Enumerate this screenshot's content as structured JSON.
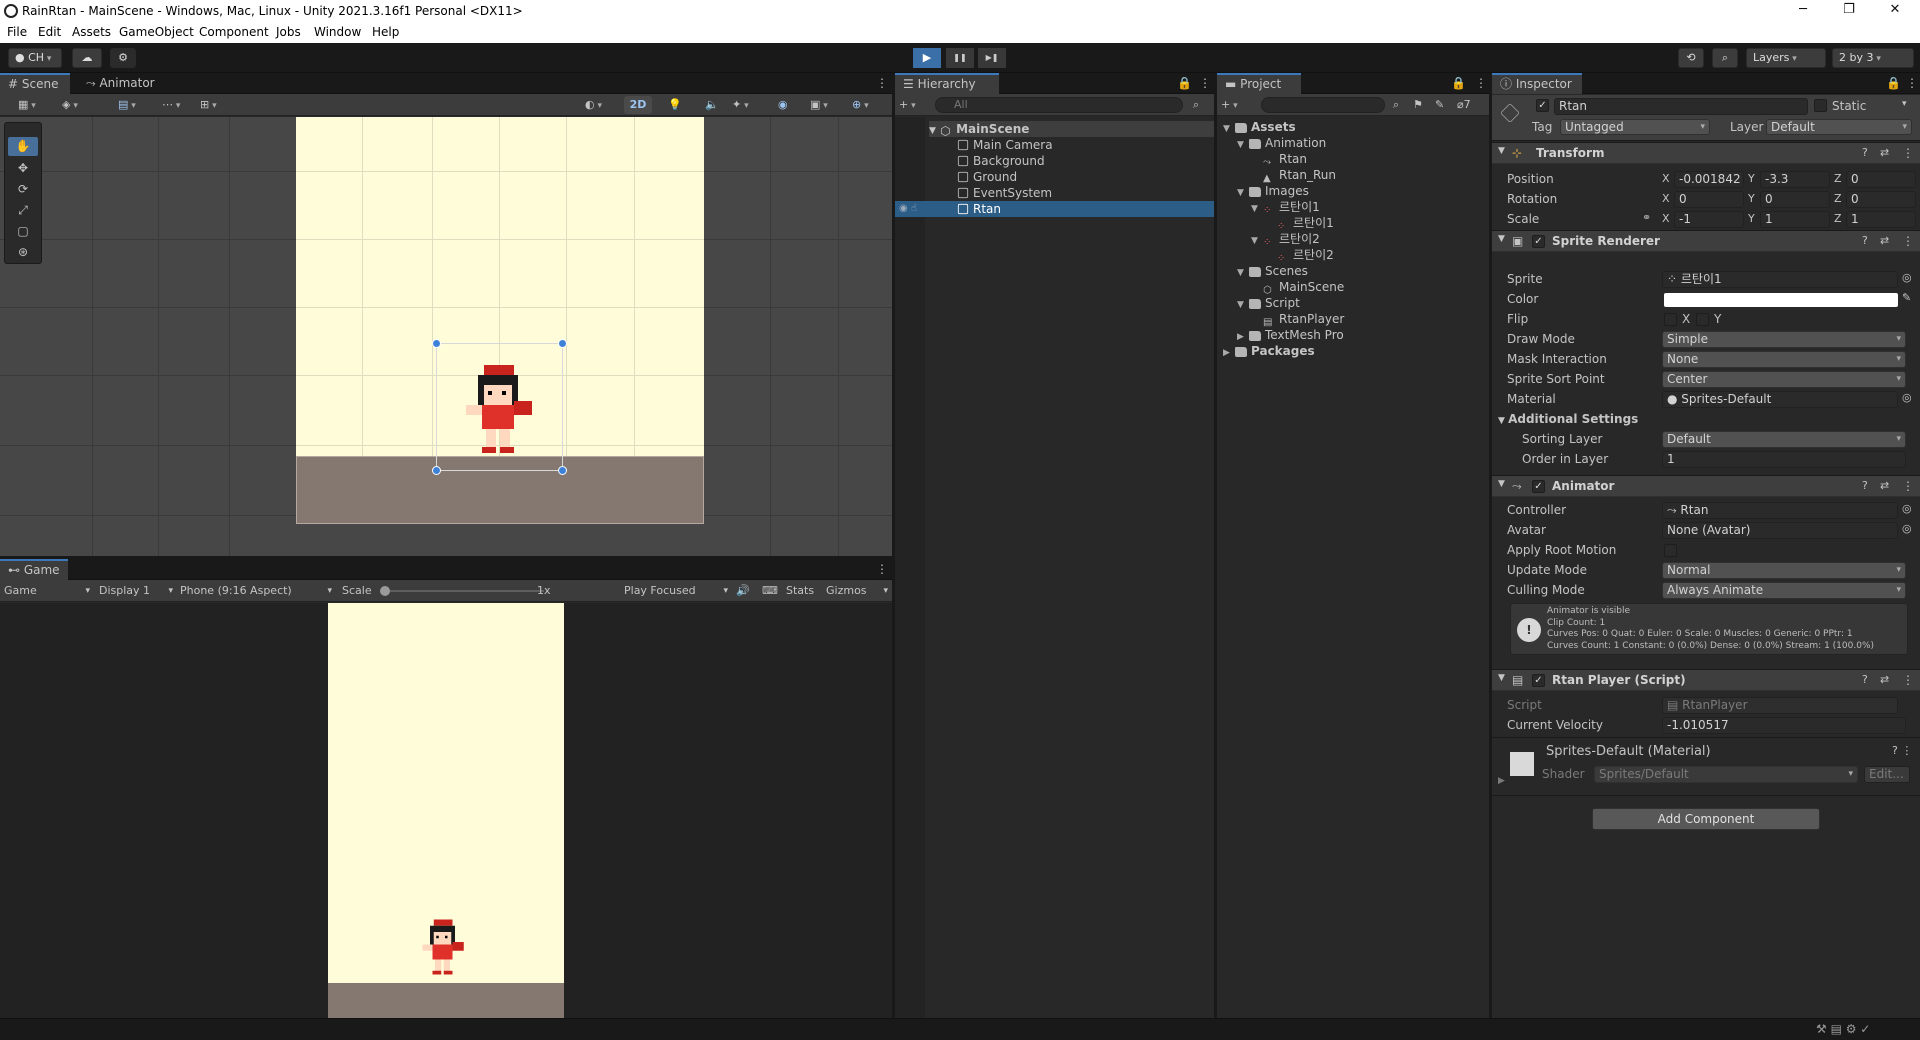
{
  "window": {
    "title": "RainRtan - MainScene - Windows, Mac, Linux - Unity 2021.3.16f1 Personal <DX11>",
    "minimize": "─",
    "maximize": "❐",
    "close": "✕"
  },
  "menu": [
    "File",
    "Edit",
    "Assets",
    "GameObject",
    "Component",
    "Jobs",
    "Window",
    "Help"
  ],
  "toolbar": {
    "account": "CH",
    "layers": "Layers",
    "layout": "2 by 3",
    "play": "▶",
    "pause": "❚❚",
    "step": "▶❚"
  },
  "scene": {
    "tabs": [
      "Scene",
      "Animator"
    ],
    "mode_2d": "2D"
  },
  "game": {
    "tab": "Game",
    "view_mode": "Game",
    "display": "Display 1",
    "aspect": "Phone (9:16 Aspect)",
    "scale_label": "Scale",
    "scale_value": "1x",
    "play_focused": "Play Focused",
    "stats": "Stats",
    "gizmos": "Gizmos"
  },
  "hierarchy": {
    "tab": "Hierarchy",
    "search_placeholder": "All",
    "scene": "MainScene",
    "items": [
      "Main Camera",
      "Background",
      "Ground",
      "EventSystem",
      "Rtan"
    ],
    "selected": "Rtan"
  },
  "project": {
    "tab": "Project",
    "count": "7",
    "tree": [
      {
        "label": "Assets",
        "level": 0,
        "kind": "folder",
        "bold": true
      },
      {
        "label": "Animation",
        "level": 1,
        "kind": "folder"
      },
      {
        "label": "Rtan",
        "level": 2,
        "kind": "controller"
      },
      {
        "label": "Rtan_Run",
        "level": 2,
        "kind": "anim"
      },
      {
        "label": "Images",
        "level": 1,
        "kind": "folder"
      },
      {
        "label": "르탄이1",
        "level": 2,
        "kind": "sprite"
      },
      {
        "label": "르탄이1",
        "level": 3,
        "kind": "sprite"
      },
      {
        "label": "르탄이2",
        "level": 2,
        "kind": "sprite"
      },
      {
        "label": "르탄이2",
        "level": 3,
        "kind": "sprite"
      },
      {
        "label": "Scenes",
        "level": 1,
        "kind": "folder"
      },
      {
        "label": "MainScene",
        "level": 2,
        "kind": "scene"
      },
      {
        "label": "Script",
        "level": 1,
        "kind": "folder"
      },
      {
        "label": "RtanPlayer",
        "level": 2,
        "kind": "script"
      },
      {
        "label": "TextMesh Pro",
        "level": 1,
        "kind": "folder"
      },
      {
        "label": "Packages",
        "level": 0,
        "kind": "folder",
        "bold": true
      }
    ]
  },
  "inspector": {
    "tab": "Inspector",
    "object_name": "Rtan",
    "static": "Static",
    "tag_label": "Tag",
    "tag": "Untagged",
    "layer_label": "Layer",
    "layer": "Default",
    "transform": {
      "title": "Transform",
      "rows": [
        {
          "label": "Position",
          "x": "-0.001842",
          "y": "-3.3",
          "z": "0"
        },
        {
          "label": "Rotation",
          "x": "0",
          "y": "0",
          "z": "0"
        },
        {
          "label": "Scale",
          "x": "-1",
          "y": "1",
          "z": "1"
        }
      ]
    },
    "sprite_renderer": {
      "title": "Sprite Renderer",
      "sprite_label": "Sprite",
      "sprite": "르탄이1",
      "color_label": "Color",
      "flip_label": "Flip",
      "flip_x": "X",
      "flip_y": "Y",
      "draw_mode_label": "Draw Mode",
      "draw_mode": "Simple",
      "mask_label": "Mask Interaction",
      "mask": "None",
      "sort_point_label": "Sprite Sort Point",
      "sort_point": "Center",
      "material_label": "Material",
      "material": "Sprites-Default",
      "additional": "Additional Settings",
      "sorting_layer_label": "Sorting Layer",
      "sorting_layer": "Default",
      "order_label": "Order in Layer",
      "order": "1"
    },
    "animator": {
      "title": "Animator",
      "controller_label": "Controller",
      "controller": "Rtan",
      "avatar_label": "Avatar",
      "avatar": "None (Avatar)",
      "root_motion_label": "Apply Root Motion",
      "update_label": "Update Mode",
      "update": "Normal",
      "culling_label": "Culling Mode",
      "culling": "Always Animate",
      "info": [
        "Animator is visible",
        "Clip Count: 1",
        "Curves Pos: 0 Quat: 0 Euler: 0 Scale: 0 Muscles: 0 Generic: 0 PPtr: 1",
        "Curves Count: 1 Constant: 0 (0.0%) Dense: 0 (0.0%) Stream: 1 (100.0%)"
      ]
    },
    "script": {
      "title": "Rtan Player (Script)",
      "script_label": "Script",
      "script": "RtanPlayer",
      "velocity_label": "Current Velocity",
      "velocity": "-1.010517"
    },
    "material": {
      "title": "Sprites-Default (Material)",
      "shader_label": "Shader",
      "shader": "Sprites/Default",
      "edit": "Edit..."
    },
    "add_component": "Add Component"
  },
  "colors": {
    "accent": "#3a79bb",
    "selection": "#2c5d87",
    "sky": "#fffdd9",
    "ground": "#847870"
  }
}
